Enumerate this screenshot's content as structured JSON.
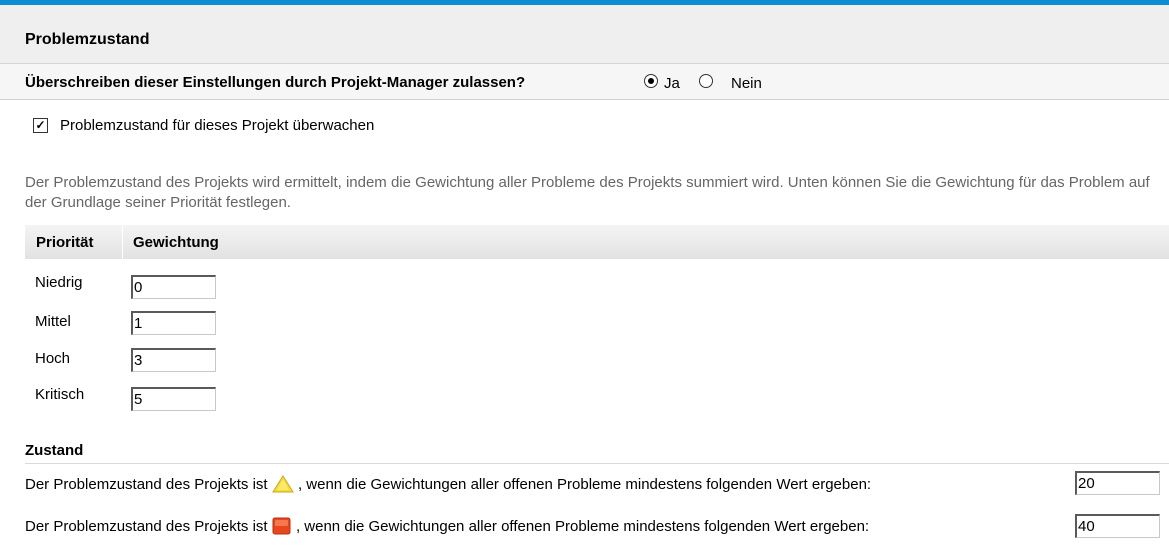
{
  "header": {
    "title": "Problemzustand"
  },
  "override": {
    "question": "Überschreiben dieser Einstellungen durch Projekt-Manager zulassen?",
    "options": [
      {
        "label": "Ja",
        "selected": true
      },
      {
        "label": "Nein",
        "selected": false
      }
    ]
  },
  "monitor": {
    "label": "Problemzustand für dieses Projekt überwachen",
    "checked": true
  },
  "description": "Der Problemzustand des Projekts wird ermittelt, indem die Gewichtung aller Probleme des Projekts summiert wird. Unten können Sie die Gewichtung für das Problem auf der Grundlage seiner Priorität festlegen.",
  "priority_table": {
    "headers": [
      "Priorität",
      "Gewichtung"
    ],
    "rows": [
      {
        "priority": "Niedrig",
        "weight": "0"
      },
      {
        "priority": "Mittel",
        "weight": "1"
      },
      {
        "priority": "Hoch",
        "weight": "3"
      },
      {
        "priority": "Kritisch",
        "weight": "5"
      }
    ]
  },
  "zustand": {
    "title": "Zustand",
    "rows": [
      {
        "prefix": "Der Problemzustand des Projekts ist",
        "icon": "warning-triangle-icon",
        "icon_color": "#f2d21b",
        "suffix": ", wenn die Gewichtungen aller offenen Probleme mindestens folgenden Wert ergeben:",
        "value": "20"
      },
      {
        "prefix": "Der Problemzustand des Projekts ist",
        "icon": "critical-square-icon",
        "icon_color": "#e8461f",
        "suffix": ", wenn die Gewichtungen aller offenen Probleme mindestens folgenden Wert ergeben:",
        "value": "40"
      }
    ]
  }
}
